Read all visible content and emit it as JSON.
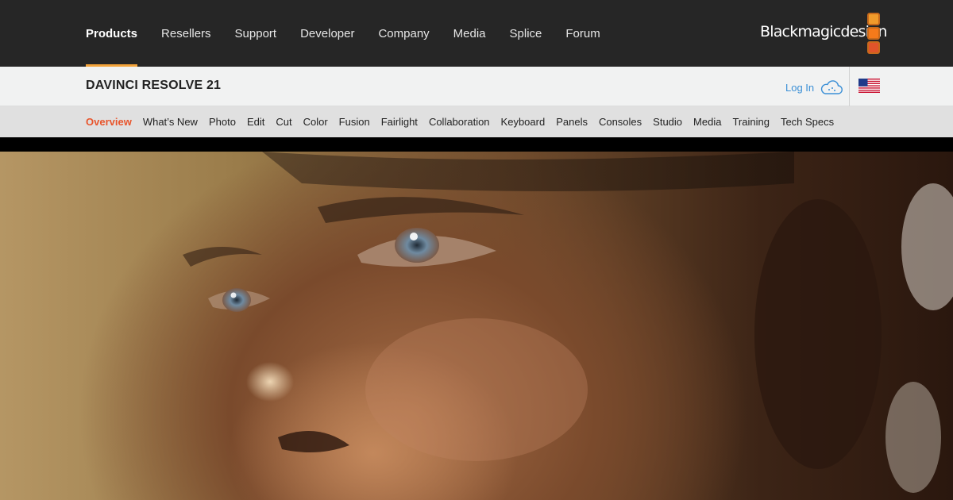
{
  "topnav": {
    "items": [
      {
        "label": "Products",
        "active": true
      },
      {
        "label": "Resellers"
      },
      {
        "label": "Support"
      },
      {
        "label": "Developer"
      },
      {
        "label": "Company"
      },
      {
        "label": "Media"
      },
      {
        "label": "Splice"
      },
      {
        "label": "Forum"
      }
    ],
    "logo_text": "Blackmagicdesign"
  },
  "product": {
    "title": "DAVINCI RESOLVE 21",
    "login_label": "Log In"
  },
  "subnav": {
    "items": [
      {
        "label": "Overview",
        "active": true
      },
      {
        "label": "What’s New"
      },
      {
        "label": "Photo"
      },
      {
        "label": "Edit"
      },
      {
        "label": "Cut"
      },
      {
        "label": "Color"
      },
      {
        "label": "Fusion"
      },
      {
        "label": "Fairlight"
      },
      {
        "label": "Collaboration"
      },
      {
        "label": "Keyboard"
      },
      {
        "label": "Panels"
      },
      {
        "label": "Consoles"
      },
      {
        "label": "Studio"
      },
      {
        "label": "Media"
      },
      {
        "label": "Training"
      },
      {
        "label": "Tech Specs"
      }
    ]
  },
  "colors": {
    "topbar": "#262626",
    "active_underline": "#f3a33a",
    "active_subnav": "#e8552c",
    "login": "#3a8fd6"
  },
  "icons": [
    "cloud-icon",
    "us-flag-icon",
    "blackmagic-logo"
  ]
}
